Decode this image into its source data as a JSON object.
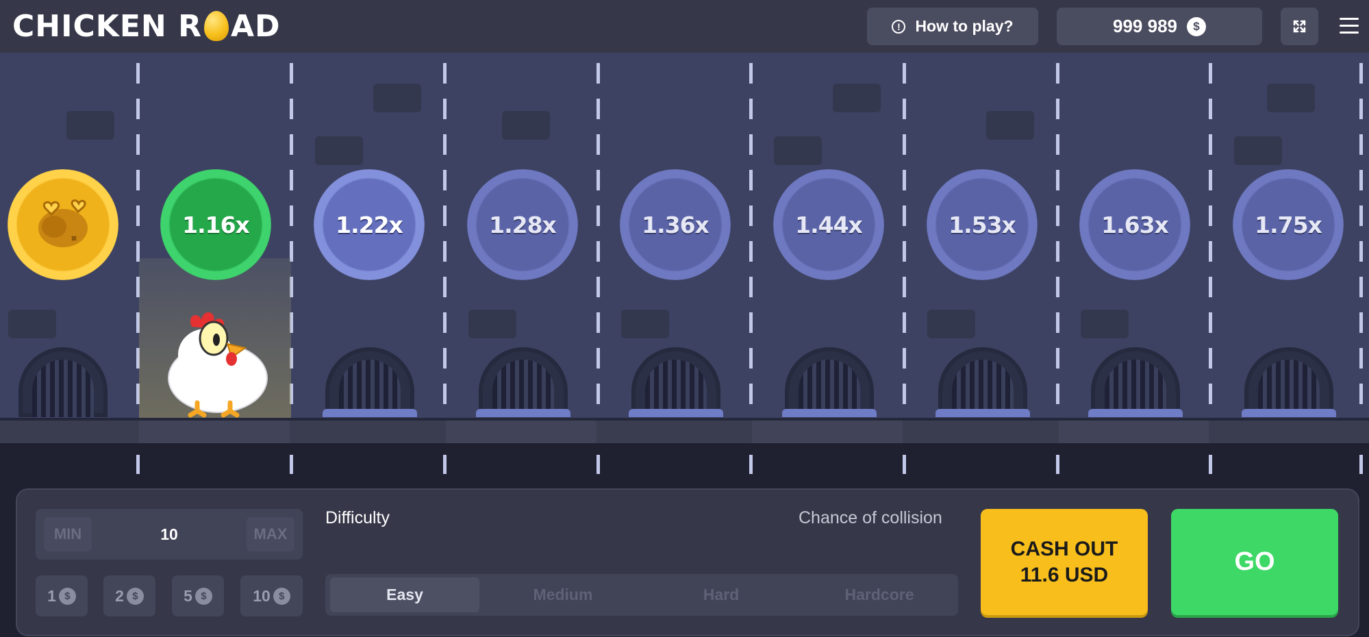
{
  "header": {
    "logo_left": "CHICKEN R",
    "logo_right": "AD",
    "how_to_play": "How to play?",
    "balance": "999 989",
    "currency_symbol": "$"
  },
  "multipliers": [
    "1.16x",
    "1.22x",
    "1.28x",
    "1.36x",
    "1.44x",
    "1.53x",
    "1.63x",
    "1.75x"
  ],
  "bet": {
    "min_label": "MIN",
    "value": "10",
    "max_label": "MAX",
    "quick_amounts": [
      "1",
      "2",
      "5",
      "10"
    ],
    "currency_symbol": "$"
  },
  "difficulty": {
    "label": "Difficulty",
    "collision_label": "Chance of collision",
    "options": [
      "Easy",
      "Medium",
      "Hard",
      "Hardcore"
    ],
    "selected": "Easy"
  },
  "actions": {
    "cashout_line1": "CASH OUT",
    "cashout_line2": "11.6 USD",
    "go": "GO"
  },
  "colors": {
    "cashout": "#f8be1c",
    "go": "#3ed866",
    "current_multiplier": "#25a84a",
    "passed_coin": "#f0b21b"
  }
}
